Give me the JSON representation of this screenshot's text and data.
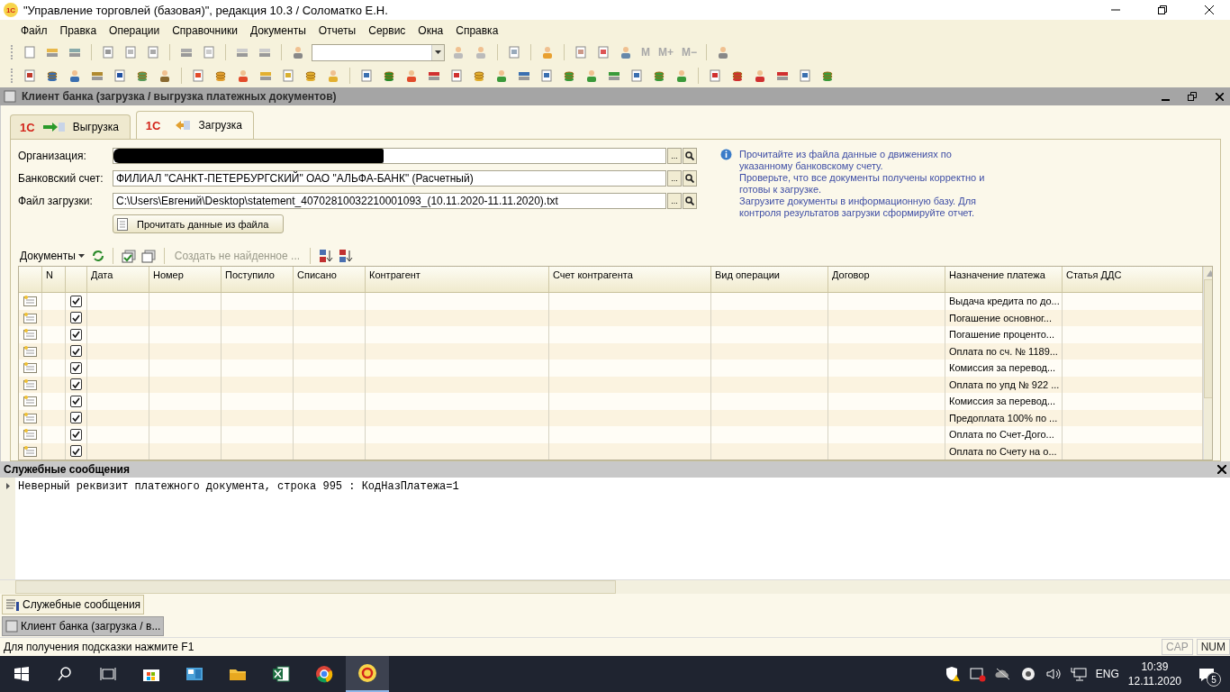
{
  "window": {
    "logo": "1С",
    "title": "\"Управление торговлей (базовая)\", редакция 10.3 / Соломатко Е.Н."
  },
  "menu": [
    "Файл",
    "Правка",
    "Операции",
    "Справочники",
    "Документы",
    "Отчеты",
    "Сервис",
    "Окна",
    "Справка"
  ],
  "toolbar_calc_letters": [
    "M",
    "M+",
    "M−"
  ],
  "document_window": {
    "title": "Клиент банка (загрузка / выгрузка платежных документов)"
  },
  "tabs": [
    {
      "logo": "1С",
      "label": "Выгрузка",
      "selected": false
    },
    {
      "logo": "1С",
      "label": "Загрузка",
      "selected": true
    }
  ],
  "form": {
    "fields": [
      {
        "label": "Организация:",
        "redacted": true
      },
      {
        "label": "Банковский счет:",
        "value": "ФИЛИАЛ \"САНКТ-ПЕТЕРБУРГСКИЙ\" ОАО \"АЛЬФА-БАНК\" (Расчетный)"
      },
      {
        "label": "Файл загрузки:",
        "value": "C:\\Users\\Евгений\\Desktop\\statement_40702810032210001093_(10.11.2020-11.11.2020).txt"
      }
    ],
    "read_button": "Прочитать данные из файла",
    "ellipsis": "...",
    "info": [
      "Прочитайте из файла данные о движениях по",
      "указанному банковскому счету.",
      "Проверьте, что все  документы получены корректно и",
      "готовы к загрузке.",
      "Загрузите документы в информационную базу. Для",
      "контроля результатов загрузки сформируйте отчет."
    ]
  },
  "table_toolbar": {
    "documents_menu": "Документы",
    "create_button": "Создать не найденное ...",
    "create_disabled": true
  },
  "table": {
    "columns": [
      "N",
      "Дата",
      "Номер",
      "Поступило",
      "Списано",
      "Контрагент",
      "Счет контрагента",
      "Вид операции",
      "Договор",
      "Назначение платежа",
      "Статья ДДС"
    ],
    "rows": [
      {
        "checked": true,
        "purpose": "Выдача кредита по до..."
      },
      {
        "checked": true,
        "purpose": "Погашение основног..."
      },
      {
        "checked": true,
        "purpose": "Погашение проценто..."
      },
      {
        "checked": true,
        "purpose": "Оплата по сч. № 1189..."
      },
      {
        "checked": true,
        "purpose": "Комиссия за перевод..."
      },
      {
        "checked": true,
        "purpose": "Оплата по упд № 922 ..."
      },
      {
        "checked": true,
        "purpose": "Комиссия за перевод..."
      },
      {
        "checked": true,
        "purpose": "Предоплата 100% по ..."
      },
      {
        "checked": true,
        "purpose": "Оплата по Счет-Дого..."
      },
      {
        "checked": true,
        "purpose": "Оплата по Счету на о..."
      }
    ]
  },
  "messages": {
    "title": "Служебные сообщения",
    "lines": [
      "Неверный реквизит платежного документа, строка 995 : КодНазПлатежа=1"
    ]
  },
  "window_panel": [
    {
      "label": "Служебные сообщения",
      "selected": false,
      "kind": "messages"
    },
    {
      "label": "Клиент банка (загрузка / в...",
      "selected": true,
      "kind": "bank"
    }
  ],
  "status_bar": {
    "hint": "Для получения подсказки нажмите F1",
    "indicators": [
      "CAP",
      "NUM"
    ]
  },
  "taskbar": {
    "language": "ENG",
    "time": "10:39",
    "date": "12.11.2020",
    "notifications": "5"
  }
}
